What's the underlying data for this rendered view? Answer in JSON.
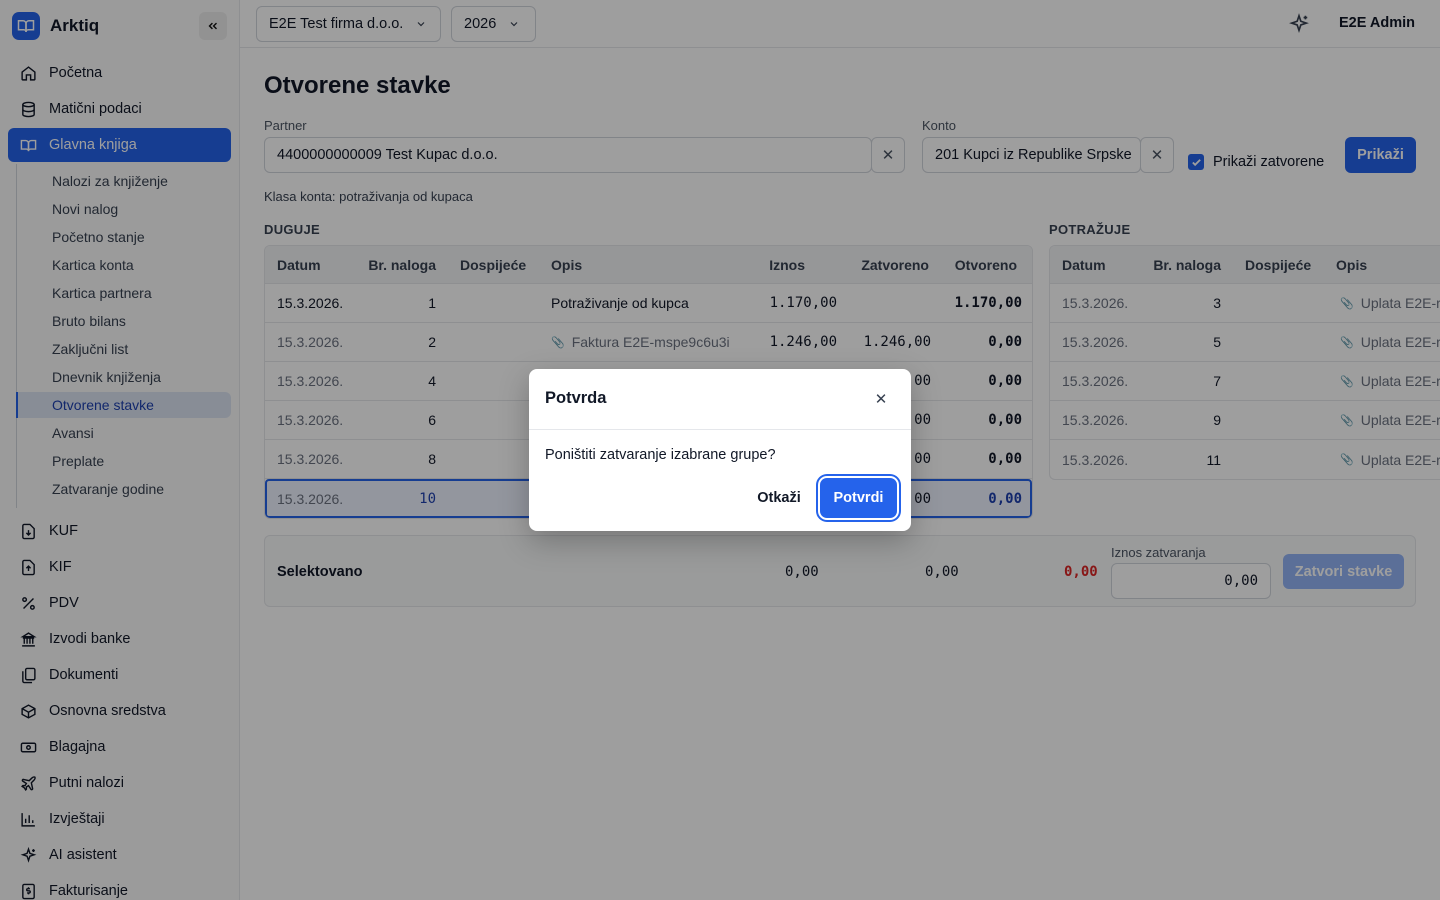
{
  "app": {
    "name": "Arktiq"
  },
  "sidebar": {
    "items": [
      {
        "label": "Početna",
        "icon": "home-icon"
      },
      {
        "label": "Matični podaci",
        "icon": "database-icon"
      },
      {
        "label": "Glavna knjiga",
        "icon": "book-icon",
        "active": true
      }
    ],
    "subitems": [
      "Nalozi za knjiženje",
      "Novi nalog",
      "Početno stanje",
      "Kartica konta",
      "Kartica partnera",
      "Bruto bilans",
      "Zaključni list",
      "Dnevnik knjiženja",
      "Otvorene stavke",
      "Avansi",
      "Preplate",
      "Zatvaranje godine"
    ],
    "active_subitem": "Otvorene stavke",
    "bottom_items": [
      {
        "label": "KUF",
        "icon": "file-download-icon"
      },
      {
        "label": "KIF",
        "icon": "file-upload-icon"
      },
      {
        "label": "PDV",
        "icon": "percent-icon"
      },
      {
        "label": "Izvodi banke",
        "icon": "bank-icon"
      },
      {
        "label": "Dokumenti",
        "icon": "documents-icon"
      },
      {
        "label": "Osnovna sredstva",
        "icon": "box-icon"
      },
      {
        "label": "Blagajna",
        "icon": "cash-icon"
      },
      {
        "label": "Putni nalozi",
        "icon": "plane-icon"
      },
      {
        "label": "Izvještaji",
        "icon": "bar-chart-icon"
      },
      {
        "label": "AI asistent",
        "icon": "sparkle-icon"
      },
      {
        "label": "Fakturisanje",
        "icon": "invoice-icon"
      }
    ]
  },
  "topbar": {
    "company": "E2E Test firma d.o.o.",
    "year": "2026",
    "user": "E2E Admin"
  },
  "page": {
    "title": "Otvorene stavke",
    "partner_label": "Partner",
    "partner_value": "4400000000009 Test Kupac d.o.o.",
    "konto_label": "Konto",
    "konto_value": "201 Kupci iz Republike Srpske",
    "show_closed_label": "Prikaži zatvorene",
    "show_closed_checked": true,
    "show_button": "Prikaži",
    "klasa": "Klasa konta: potraživanja od kupaca"
  },
  "duguje": {
    "label": "DUGUJE",
    "headers": [
      "Datum",
      "Br. naloga",
      "Dospijeće",
      "Opis",
      "Iznos",
      "Zatvoreno",
      "Otvoreno"
    ],
    "rows": [
      {
        "datum": "15.3.2026.",
        "nalog": "1",
        "dospijece": "",
        "opis": "Potraživanje od kupca",
        "attach": false,
        "iznos": "1.170,00",
        "zatvoreno": "",
        "otvoreno": "1.170,00",
        "closed": false
      },
      {
        "datum": "15.3.2026.",
        "nalog": "2",
        "dospijece": "",
        "opis": "Faktura E2E-mspe9c6u3i",
        "attach": true,
        "iznos": "1.246,00",
        "zatvoreno": "1.246,00",
        "otvoreno": "0,00",
        "closed": true
      },
      {
        "datum": "15.3.2026.",
        "nalog": "4",
        "dospijece": "",
        "opis": "",
        "attach": false,
        "iznos": "",
        "zatvoreno": "00",
        "otvoreno": "0,00",
        "closed": true
      },
      {
        "datum": "15.3.2026.",
        "nalog": "6",
        "dospijece": "",
        "opis": "",
        "attach": false,
        "iznos": "",
        "zatvoreno": "00",
        "otvoreno": "0,00",
        "closed": true
      },
      {
        "datum": "15.3.2026.",
        "nalog": "8",
        "dospijece": "",
        "opis": "",
        "attach": false,
        "iznos": "",
        "zatvoreno": "00",
        "otvoreno": "0,00",
        "closed": true
      },
      {
        "datum": "15.3.2026.",
        "nalog": "10",
        "dospijece": "",
        "opis": "",
        "attach": false,
        "iznos": "",
        "zatvoreno": "00",
        "otvoreno": "0,00",
        "closed": true,
        "selected": true
      }
    ]
  },
  "potrazuje": {
    "label": "POTRAŽUJE",
    "headers": [
      "Datum",
      "Br. naloga",
      "Dospijeće",
      "Opis"
    ],
    "rows": [
      {
        "datum": "15.3.2026.",
        "nalog": "3",
        "opis": "Uplata E2E-r"
      },
      {
        "datum": "15.3.2026.",
        "nalog": "5",
        "opis": "Uplata E2E-r"
      },
      {
        "datum": "15.3.2026.",
        "nalog": "7",
        "opis": "Uplata E2E-r"
      },
      {
        "datum": "15.3.2026.",
        "nalog": "9",
        "opis": "Uplata E2E-r"
      },
      {
        "datum": "15.3.2026.",
        "nalog": "11",
        "opis": "Uplata E2E-r"
      }
    ]
  },
  "summary": {
    "label": "Selektovano",
    "duguje": "0,00",
    "potrazuje": "0,00",
    "razlika": "0,00",
    "iznos_label": "Iznos zatvaranja",
    "iznos_value": "0,00",
    "close_button": "Zatvori stavke"
  },
  "modal": {
    "title": "Potvrda",
    "message": "Poništiti zatvaranje izabrane grupe?",
    "cancel": "Otkaži",
    "confirm": "Potvrdi"
  },
  "colors": {
    "primary": "#2563eb",
    "danger": "#dc2626"
  }
}
